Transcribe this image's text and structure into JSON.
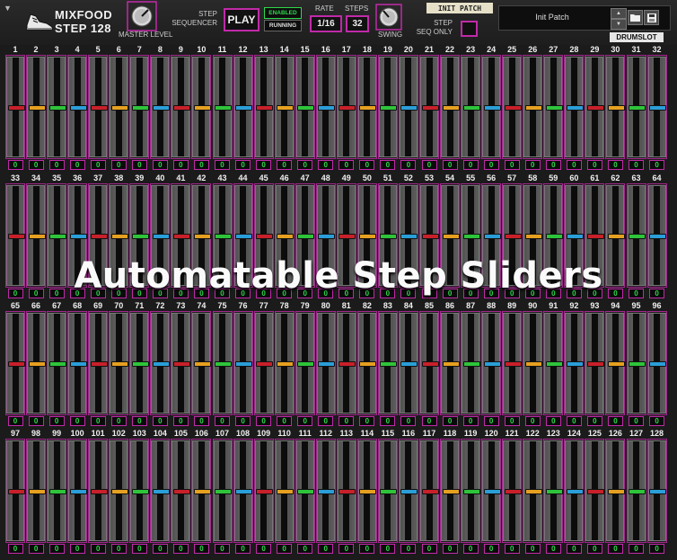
{
  "header": {
    "logo_line1": "MIXFOOD",
    "logo_line2": "STEP 128",
    "master_label": "MASTER LEVEL",
    "seq_label_line1": "STEP",
    "seq_label_line2": "SEQUENCER",
    "play_label": "PLAY",
    "enabled_label": "ENABLED",
    "running_label": "RUNNING",
    "rate_label": "RATE",
    "rate_value": "1/16",
    "steps_label": "STEPS",
    "steps_value": "32",
    "swing_label": "SWING",
    "init_patch_label": "INIT PATCH",
    "seq_only_line1": "STEP",
    "seq_only_line2": "SEQ ONLY",
    "preset_name": "Init Patch",
    "drumslot_label": "DRUMSLOT"
  },
  "icons": {
    "menu": "chevron-down-icon",
    "logo": "sneaker-icon",
    "preset_prev": "arrow-up-icon",
    "preset_next": "arrow-down-icon",
    "folder": "folder-icon",
    "save": "save-icon"
  },
  "colors": {
    "accent": "#c02aa8",
    "value_text": "#2fd94c",
    "cap_cycle": [
      "#c8202a",
      "#e6a020",
      "#2ec43a",
      "#2a9ed8"
    ]
  },
  "steps": {
    "count": 128,
    "per_row": 32,
    "values": [
      0,
      0,
      0,
      0,
      0,
      0,
      0,
      0,
      0,
      0,
      0,
      0,
      0,
      0,
      0,
      0,
      0,
      0,
      0,
      0,
      0,
      0,
      0,
      0,
      0,
      0,
      0,
      0,
      0,
      0,
      0,
      0,
      0,
      0,
      0,
      0,
      0,
      0,
      0,
      0,
      0,
      0,
      0,
      0,
      0,
      0,
      0,
      0,
      0,
      0,
      0,
      0,
      0,
      0,
      0,
      0,
      0,
      0,
      0,
      0,
      0,
      0,
      0,
      0,
      0,
      0,
      0,
      0,
      0,
      0,
      0,
      0,
      0,
      0,
      0,
      0,
      0,
      0,
      0,
      0,
      0,
      0,
      0,
      0,
      0,
      0,
      0,
      0,
      0,
      0,
      0,
      0,
      0,
      0,
      0,
      0,
      0,
      0,
      0,
      0,
      0,
      0,
      0,
      0,
      0,
      0,
      0,
      0,
      0,
      0,
      0,
      0,
      0,
      0,
      0,
      0,
      0,
      0,
      0,
      0,
      0,
      0,
      0,
      0,
      0,
      0,
      0,
      0
    ]
  },
  "overlay_title": "Automatable Step Sliders"
}
